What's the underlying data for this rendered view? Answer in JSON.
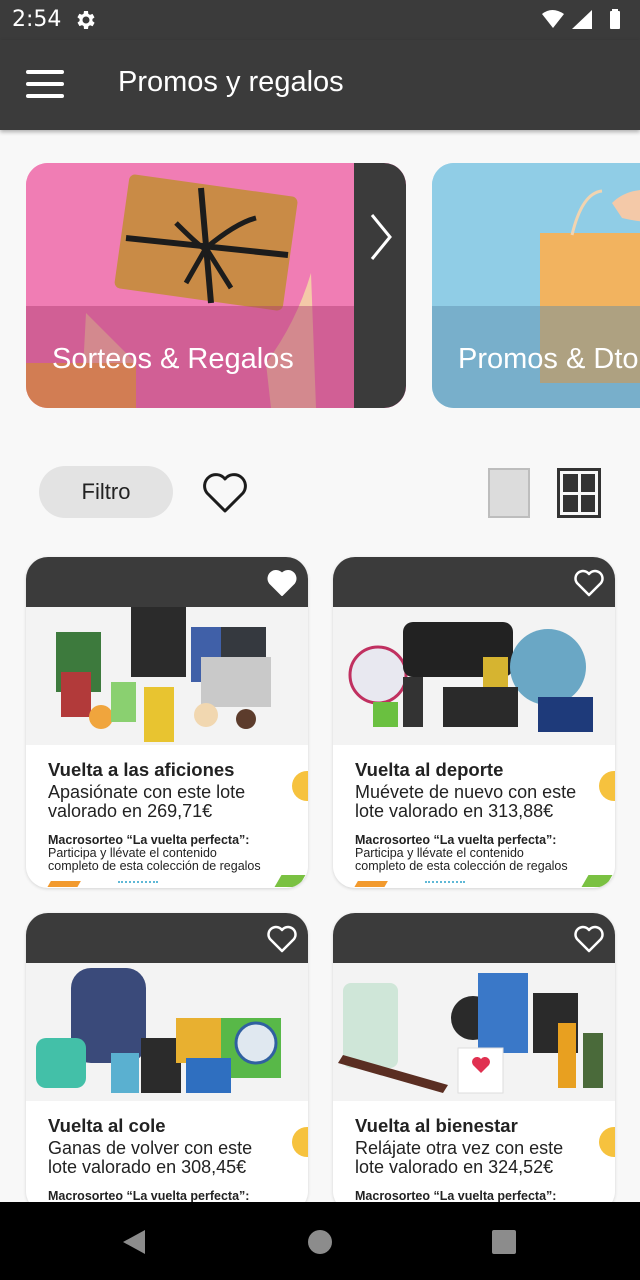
{
  "status_bar": {
    "time": "2:54"
  },
  "app_bar": {
    "title": "Promos y regalos"
  },
  "categories": [
    {
      "label": "Sorteos & Regalos"
    },
    {
      "label": "Promos & Dto"
    }
  ],
  "filters": {
    "filter_label": "Filtro"
  },
  "cards": [
    {
      "title": "Vuelta a las aficiones",
      "desc_line1": "Apasiónate con este lote",
      "desc_line2": "valorado en 269,71€",
      "macro": "Macrosorteo “La vuelta perfecta”:",
      "sub_line1": "Participa y llévate el contenido",
      "sub_line2": "completo de esta colección de regalos"
    },
    {
      "title": "Vuelta al deporte",
      "desc_line1": "Muévete de nuevo con este",
      "desc_line2": "lote valorado en 313,88€",
      "macro": "Macrosorteo “La vuelta perfecta”:",
      "sub_line1": "Participa y llévate el contenido",
      "sub_line2": "completo de esta colección de regalos"
    },
    {
      "title": "Vuelta al cole",
      "desc_line1": "Ganas de volver con este",
      "desc_line2": "lote valorado en 308,45€",
      "macro": "Macrosorteo “La vuelta perfecta”:"
    },
    {
      "title": "Vuelta al bienestar",
      "desc_line1": "Relájate otra vez con este",
      "desc_line2": "lote valorado en 324,52€",
      "macro": "Macrosorteo “La vuelta perfecta”:"
    }
  ],
  "colors": {
    "bar": "#3b3b3b",
    "category_pink": "#f07db4",
    "category_blue": "#90cde6",
    "accent_yellow": "#f6c23e"
  }
}
